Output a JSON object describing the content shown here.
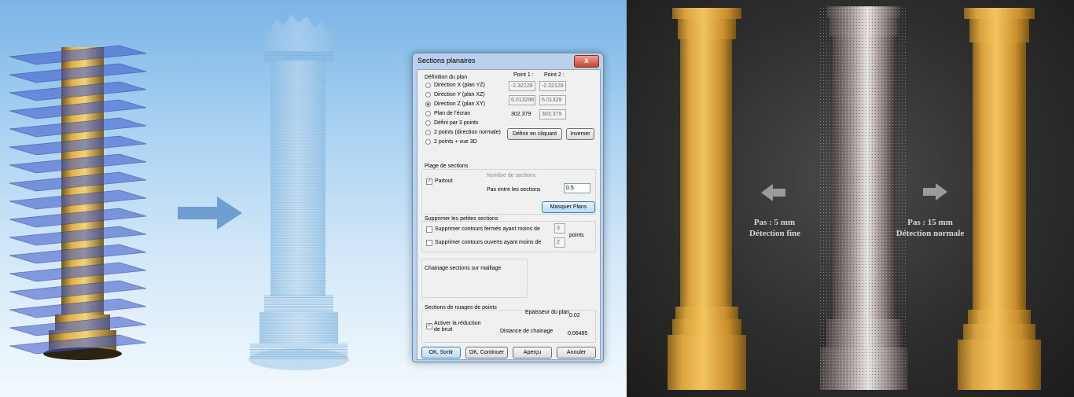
{
  "dialog": {
    "title": "Sections planaires",
    "close_glyph": "x",
    "plane_group": "Définition du plan",
    "point1_header": "Point 1 :",
    "point2_header": "Point 2 :",
    "options": [
      "Direction X (plan YZ)",
      "Direction Y (plan XZ)",
      "Direction Z (plan XY)",
      "Plan de l'écran",
      "Défini par 3 points",
      "2 points (direction normale)",
      "2 points + vue 3D"
    ],
    "selected_option": 2,
    "point1_values": [
      "-2.32128",
      "6.013298",
      "302.379"
    ],
    "point2_values": [
      "-2.32128",
      "6.01329",
      "303.379"
    ],
    "define_by_click": "Définir en cliquant",
    "invert": "Inverser",
    "range_group": "Plage de sections",
    "everywhere_label": "Partout",
    "everywhere_checked": true,
    "section_count_label": "Nombre de sections",
    "step_label": "Pas entre les sections",
    "step_value": "0.5",
    "hide_planes": "Masquer Plans",
    "remove_group": "Supprimer les petites sections",
    "remove_closed_label": "Supprimer contours fermés ayant moins de",
    "remove_closed_value": "3",
    "remove_open_label": "Supprimer contours ouverts ayant moins de",
    "remove_open_value": "2",
    "points_unit": "points",
    "mesh_group": "Chainage sections sur maillage",
    "cloud_group": "Sections de nuages de points",
    "thickness_label": "Epaisseur du plan",
    "thickness_value": "0.02",
    "noise_label_1": "Activer la réduction",
    "noise_label_2": "de bruit",
    "noise_checked": true,
    "chain_distance_label": "Distance de chainage",
    "chain_distance_value": "0.06485",
    "ok_exit": "OK, Sortir",
    "ok_continue": "OK, Continuer",
    "preview": "Aperçu",
    "cancel": "Annuler"
  },
  "comparison": {
    "left_line1": "Pas : 5 mm",
    "left_line2": "Détection fine",
    "right_line1": "Pas : 15 mm",
    "right_line2": "Détection normale"
  },
  "colors": {
    "plane_blue": "#3a55c8",
    "column_yellow": "#e2b24a",
    "pointcloud_blue": "#9fc6e6",
    "arrow_blue": "#6f9ed0",
    "arrow_gray": "#9b9b9b"
  },
  "icons": {
    "flow_arrow": "right-arrow-icon",
    "left_arrow": "left-arrow-icon",
    "right_arrow": "right-arrow-icon"
  }
}
